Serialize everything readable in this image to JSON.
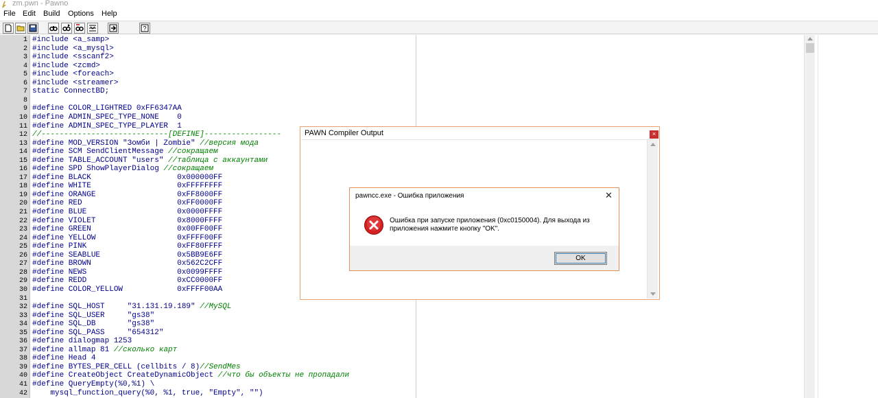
{
  "window": {
    "title": "zm.pwn - Pawno"
  },
  "menu": [
    "File",
    "Edit",
    "Build",
    "Options",
    "Help"
  ],
  "toolbar": [
    "new-file-icon",
    "open-folder-icon",
    "save-icon",
    "find-icon",
    "find-next-icon",
    "replace-icon",
    "goto-line-icon",
    "compile-icon",
    "help-icon"
  ],
  "editor": {
    "lines": [
      {
        "n": "1",
        "code": "#include <a_samp>",
        "comment": ""
      },
      {
        "n": "2",
        "code": "#include <a_mysql>",
        "comment": ""
      },
      {
        "n": "3",
        "code": "#include <sscanf2>",
        "comment": ""
      },
      {
        "n": "4",
        "code": "#include <zcmd>",
        "comment": ""
      },
      {
        "n": "5",
        "code": "#include <foreach>",
        "comment": ""
      },
      {
        "n": "6",
        "code": "#include <streamer>",
        "comment": ""
      },
      {
        "n": "7",
        "code": "static ConnectBD;",
        "comment": ""
      },
      {
        "n": "8",
        "code": "",
        "comment": ""
      },
      {
        "n": "9",
        "code": "#define COLOR_LIGHTRED 0xFF6347AA",
        "comment": ""
      },
      {
        "n": "10",
        "code": "#define ADMIN_SPEC_TYPE_NONE    0",
        "comment": ""
      },
      {
        "n": "11",
        "code": "#define ADMIN_SPEC_TYPE_PLAYER  1",
        "comment": ""
      },
      {
        "n": "12",
        "code": "",
        "comment": "//----------------------------[DEFINE]-----------------"
      },
      {
        "n": "13",
        "code": "#define MOD_VERSION \"Зомби | Zombie\" ",
        "comment": "//версия мода"
      },
      {
        "n": "14",
        "code": "#define SCM SendClientMessage ",
        "comment": "//сокращаем"
      },
      {
        "n": "15",
        "code": "#define TABLE_ACCOUNT \"users\" ",
        "comment": "//таблица с аккаунтами"
      },
      {
        "n": "16",
        "code": "#define SPD ShowPlayerDialog ",
        "comment": "//сокращаем"
      },
      {
        "n": "17",
        "code": "#define BLACK                   0x000000FF",
        "comment": ""
      },
      {
        "n": "18",
        "code": "#define WHITE                   0xFFFFFFFF",
        "comment": ""
      },
      {
        "n": "19",
        "code": "#define ORANGE                  0xFF8000FF",
        "comment": ""
      },
      {
        "n": "20",
        "code": "#define RED                     0xFF0000FF",
        "comment": ""
      },
      {
        "n": "21",
        "code": "#define BLUE                    0x0000FFFF",
        "comment": ""
      },
      {
        "n": "22",
        "code": "#define VIOLET                  0x8000FFFF",
        "comment": ""
      },
      {
        "n": "23",
        "code": "#define GREEN                   0x00FF00FF",
        "comment": ""
      },
      {
        "n": "24",
        "code": "#define YELLOW                  0xFFFF00FF",
        "comment": ""
      },
      {
        "n": "25",
        "code": "#define PINK                    0xFF80FFFF",
        "comment": ""
      },
      {
        "n": "26",
        "code": "#define SEABLUE                 0x5BB9E6FF",
        "comment": ""
      },
      {
        "n": "27",
        "code": "#define BROWN                   0x562C2CFF",
        "comment": ""
      },
      {
        "n": "28",
        "code": "#define NEWS                    0x0099FFFF",
        "comment": ""
      },
      {
        "n": "29",
        "code": "#define REDD                    0xCC0000FF",
        "comment": ""
      },
      {
        "n": "30",
        "code": "#define COLOR_YELLOW            0xFFFF00AA",
        "comment": ""
      },
      {
        "n": "31",
        "code": "",
        "comment": ""
      },
      {
        "n": "32",
        "code": "#define SQL_HOST     \"31.131.19.189\" ",
        "comment": "//MySQL"
      },
      {
        "n": "33",
        "code": "#define SQL_USER     \"gs38\"",
        "comment": ""
      },
      {
        "n": "34",
        "code": "#define SQL_DB       \"gs38\"",
        "comment": ""
      },
      {
        "n": "35",
        "code": "#define SQL_PASS     \"654312\"",
        "comment": ""
      },
      {
        "n": "36",
        "code": "#define dialogmap 1253",
        "comment": ""
      },
      {
        "n": "37",
        "code": "#define allmap 81 ",
        "comment": "//сколько карт"
      },
      {
        "n": "38",
        "code": "#define Head 4",
        "comment": ""
      },
      {
        "n": "39",
        "code": "#define BYTES_PER_CELL (cellbits / 8)",
        "comment": "//SendMes"
      },
      {
        "n": "40",
        "code": "#define CreateObject CreateDynamicObject ",
        "comment": "//что бы объекты не пропадали"
      },
      {
        "n": "41",
        "code": "#define QueryEmpty(%0,%1) \\",
        "comment": ""
      },
      {
        "n": "42",
        "code": "    mysql_function_query(%0, %1, true, \"Empty\", \"\")",
        "comment": ""
      }
    ]
  },
  "compiler": {
    "title": "PAWN Compiler Output",
    "close": "×"
  },
  "error_dialog": {
    "title": "pawncc.exe - Ошибка приложения",
    "close": "✕",
    "message": "Ошибка при запуске приложения (0xc0150004). Для выхода из приложения нажмите кнопку \"OK\".",
    "ok": "OK",
    "icon": "error-icon"
  },
  "colors": {
    "code": "#00008b",
    "comment": "#008000",
    "gutter": "#d8d8d8",
    "accent": "#e8905a"
  }
}
